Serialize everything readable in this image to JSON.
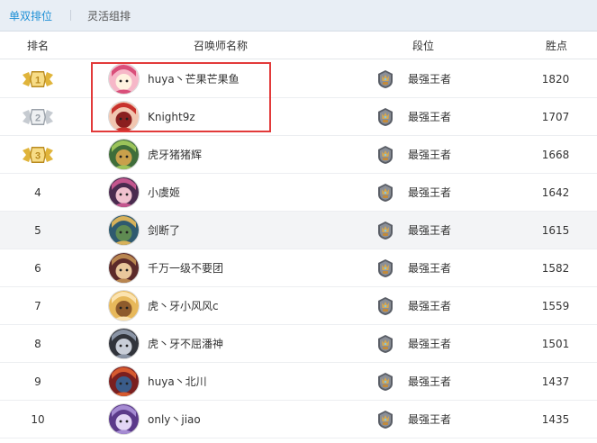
{
  "tabs": [
    {
      "label": "单双排位",
      "active": true
    },
    {
      "label": "灵活组排",
      "active": false
    }
  ],
  "columns": {
    "rank": "排名",
    "name": "召唤师名称",
    "tier": "段位",
    "points": "胜点"
  },
  "colors": {
    "accent": "#1e90d6",
    "highlight_border": "#e23a3a",
    "gold": "#e0b43a",
    "silver": "#c8cdd3"
  },
  "rows": [
    {
      "rank": "1",
      "medal": "gold",
      "name": "huya丶芒果芒果鱼",
      "tier": "最强王者",
      "points": "1820",
      "avatar": "pink-champion-avatar"
    },
    {
      "rank": "2",
      "medal": "silver",
      "name": "Knight9z",
      "tier": "最强王者",
      "points": "1707",
      "avatar": "red-hair-champion-avatar"
    },
    {
      "rank": "3",
      "medal": "gold",
      "name": "虎牙猪猪辉",
      "tier": "最强王者",
      "points": "1668",
      "avatar": "green-champion-avatar"
    },
    {
      "rank": "4",
      "medal": "",
      "name": "小虞姬",
      "tier": "最强王者",
      "points": "1642",
      "avatar": "purple-champion-avatar"
    },
    {
      "rank": "5",
      "medal": "",
      "name": "剑断了",
      "tier": "最强王者",
      "points": "1615",
      "avatar": "blonde-champion-avatar"
    },
    {
      "rank": "6",
      "medal": "",
      "name": "千万一级不要团",
      "tier": "最强王者",
      "points": "1582",
      "avatar": "hat-champion-avatar"
    },
    {
      "rank": "7",
      "medal": "",
      "name": "虎丶牙小风风c",
      "tier": "最强王者",
      "points": "1559",
      "avatar": "blonde-girl-champion-avatar"
    },
    {
      "rank": "8",
      "medal": "",
      "name": "虎丶牙不屈潘神",
      "tier": "最强王者",
      "points": "1501",
      "avatar": "armored-champion-avatar"
    },
    {
      "rank": "9",
      "medal": "",
      "name": "huya丶北川",
      "tier": "最强王者",
      "points": "1437",
      "avatar": "red-demon-champion-avatar"
    },
    {
      "rank": "10",
      "medal": "",
      "name": "only丶jiao",
      "tier": "最强王者",
      "points": "1435",
      "avatar": "purple-mage-champion-avatar"
    }
  ]
}
